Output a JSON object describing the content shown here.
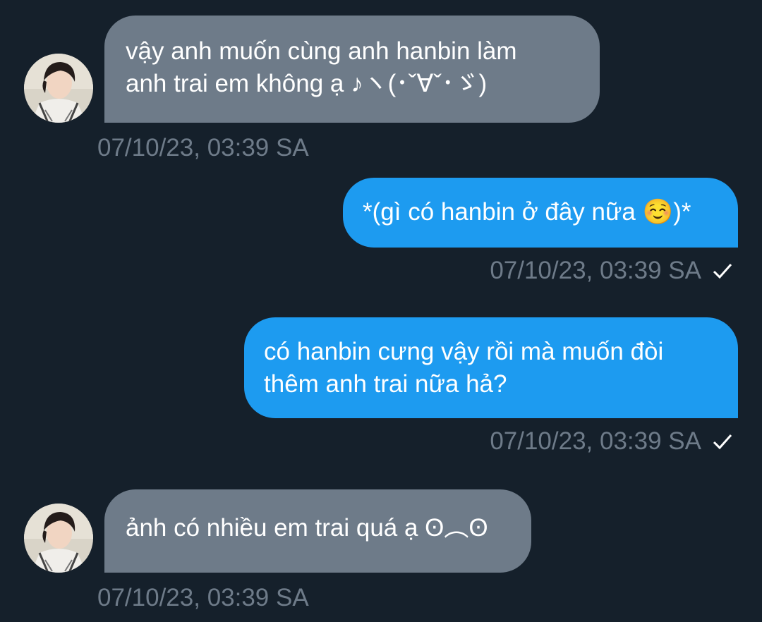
{
  "colors": {
    "background": "#15202b",
    "incoming_bubble": "#6e7b89",
    "outgoing_bubble": "#1d9bf0",
    "timestamp": "#6e7b89",
    "text": "#ffffff"
  },
  "messages": [
    {
      "direction": "incoming",
      "lines": [
        "vậy anh muốn cùng anh hanbin làm",
        "anh trai em không ạ ♪ヽ(･ˇ∀ˇ･ゞ)"
      ],
      "timestamp": "07/10/23, 03:39 SA",
      "avatar_icon": "user-avatar-icon"
    },
    {
      "direction": "outgoing",
      "lines": [
        "*(gì có hanbin ở đây nữa ☺️)*"
      ],
      "timestamp": "07/10/23, 03:39 SA",
      "status_icon": "checkmark-icon"
    },
    {
      "direction": "outgoing",
      "lines": [
        "có hanbin cưng vậy rồi mà muốn đòi",
        "thêm anh trai nữa hả?"
      ],
      "timestamp": "07/10/23, 03:39 SA",
      "status_icon": "checkmark-icon"
    },
    {
      "direction": "incoming",
      "lines": [
        "ảnh có nhiều em trai quá ạ ʘ︵ʘ"
      ],
      "timestamp": "07/10/23, 03:39 SA",
      "avatar_icon": "user-avatar-icon"
    }
  ]
}
